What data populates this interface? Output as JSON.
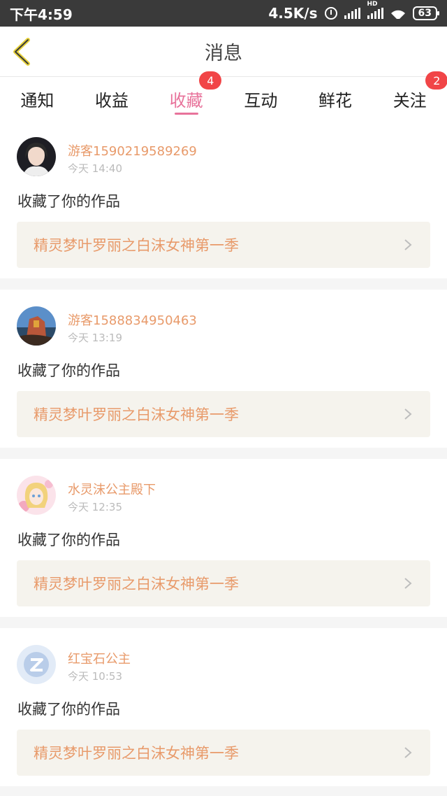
{
  "status_bar": {
    "time": "下午4:59",
    "speed": "4.5K/s",
    "hd": "HD",
    "battery": "63"
  },
  "header": {
    "title": "消息"
  },
  "tabs": [
    {
      "label": "通知",
      "active": false,
      "badge": ""
    },
    {
      "label": "收益",
      "active": false,
      "badge": ""
    },
    {
      "label": "收藏",
      "active": true,
      "badge": "4"
    },
    {
      "label": "互动",
      "active": false,
      "badge": ""
    },
    {
      "label": "鲜花",
      "active": false,
      "badge": ""
    },
    {
      "label": "关注",
      "active": false,
      "badge": "2"
    }
  ],
  "messages": [
    {
      "user": "游客1590219589269",
      "time": "今天 14:40",
      "action": "收藏了你的作品",
      "work": "精灵梦叶罗丽之白沫女神第一季",
      "avatar": "avatar-photo"
    },
    {
      "user": "游客1588834950463",
      "time": "今天 13:19",
      "action": "收藏了你的作品",
      "work": "精灵梦叶罗丽之白沫女神第一季",
      "avatar": "avatar-landscape"
    },
    {
      "user": "水灵沫公主殿下",
      "time": "今天 12:35",
      "action": "收藏了你的作品",
      "work": "精灵梦叶罗丽之白沫女神第一季",
      "avatar": "avatar-anime"
    },
    {
      "user": "红宝石公主",
      "time": "今天 10:53",
      "action": "收藏了你的作品",
      "work": "精灵梦叶罗丽之白沫女神第一季",
      "avatar": "avatar-default-qq"
    }
  ],
  "colors": {
    "accent": "#e8739b",
    "username": "#e89a6a",
    "badge": "#f14547",
    "work_bg": "#f5f3ed"
  }
}
